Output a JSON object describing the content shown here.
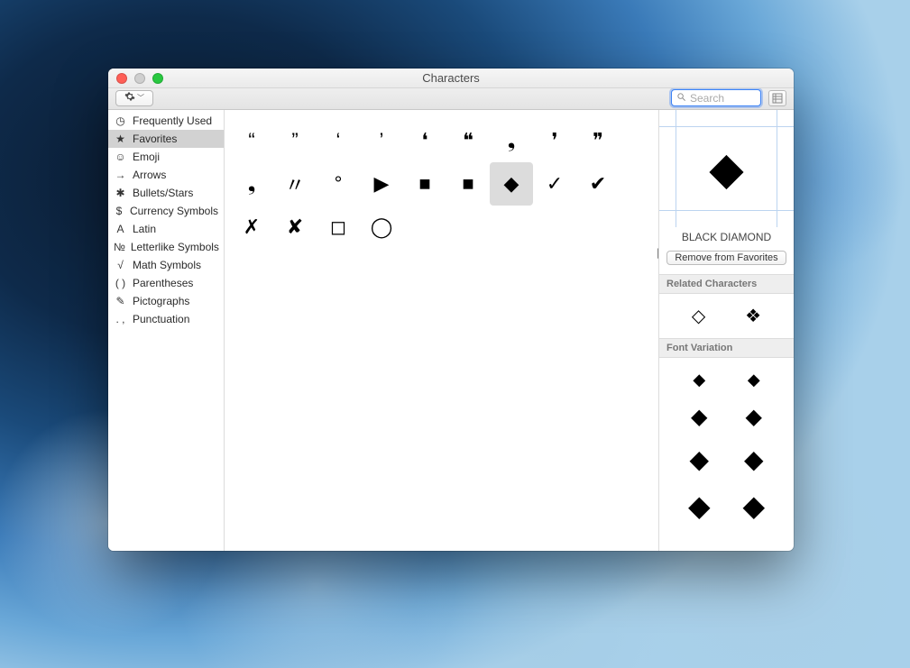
{
  "window": {
    "title": "Characters"
  },
  "toolbar": {
    "search_placeholder": "Search"
  },
  "sidebar": {
    "items": [
      {
        "icon": "clock-icon",
        "glyph": "◷",
        "label": "Frequently Used"
      },
      {
        "icon": "star-icon",
        "glyph": "★",
        "label": "Favorites",
        "selected": true
      },
      {
        "icon": "emoji-icon",
        "glyph": "☺",
        "label": "Emoji"
      },
      {
        "icon": "arrow-icon",
        "glyph": "→",
        "label": "Arrows"
      },
      {
        "icon": "bullet-icon",
        "glyph": "✱",
        "label": "Bullets/Stars"
      },
      {
        "icon": "currency-icon",
        "glyph": "$",
        "label": "Currency Symbols"
      },
      {
        "icon": "latin-icon",
        "glyph": "A",
        "label": "Latin"
      },
      {
        "icon": "letterlike-icon",
        "glyph": "№",
        "label": "Letterlike Symbols"
      },
      {
        "icon": "math-icon",
        "glyph": "√",
        "label": "Math Symbols"
      },
      {
        "icon": "paren-icon",
        "glyph": "( )",
        "label": "Parentheses"
      },
      {
        "icon": "pictograph-icon",
        "glyph": "✎",
        "label": "Pictographs"
      },
      {
        "icon": "punctuation-icon",
        "glyph": ". ,",
        "label": "Punctuation"
      }
    ]
  },
  "grid": {
    "chars": [
      "“",
      "”",
      "‘",
      "’",
      "❛",
      "❝",
      "❟",
      "❜",
      "❞",
      "❟",
      "〃",
      "°",
      "▶",
      "■",
      "■",
      "◆",
      "✓",
      "✔",
      "✗",
      "✘",
      "◻",
      "◯"
    ],
    "selected_index": 15
  },
  "info": {
    "selected_glyph": "◆",
    "name": "BLACK DIAMOND",
    "remove_label": "Remove from Favorites",
    "related_header": "Related Characters",
    "related": [
      "◇",
      "❖"
    ],
    "variation_header": "Font Variation",
    "variations": [
      "◆",
      "◆",
      "◆",
      "◆",
      "◆",
      "◆",
      "◆",
      "◆"
    ]
  }
}
